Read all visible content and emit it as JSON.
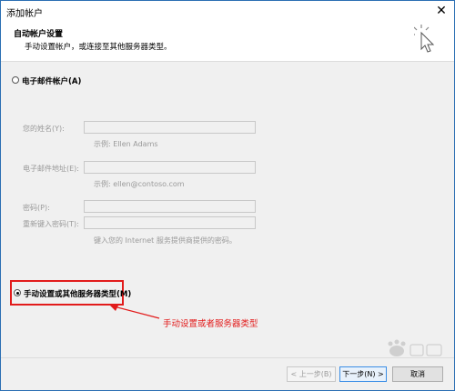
{
  "window": {
    "title": "添加帐户",
    "close_glyph": "✕"
  },
  "header": {
    "title": "自动帐户设置",
    "subtitle": "手动设置帐户，或连接至其他服务器类型。",
    "icon": "cursor-click-icon"
  },
  "email_option": {
    "label": "电子邮件帐户(A)",
    "selected": false
  },
  "form": {
    "name_label": "您的姓名(Y):",
    "name_hint": "示例: Ellen Adams",
    "email_label": "电子邮件地址(E):",
    "email_hint": "示例: ellen@contoso.com",
    "password_label": "密码(P):",
    "retype_label": "重新键入密码(T):",
    "password_hint": "键入您的 Internet 服务提供商提供的密码。"
  },
  "manual_option": {
    "label": "手动设置或其他服务器类型(M)",
    "selected": true
  },
  "annotation": {
    "text": "手动设置或者服务器类型",
    "color": "#e21b1b"
  },
  "buttons": {
    "back": "< 上一步(B)",
    "next": "下一步(N) >",
    "cancel": "取消"
  },
  "colors": {
    "accent": "#3a8ee6",
    "frame": "#2b6fb3",
    "highlight": "#e21b1b"
  }
}
